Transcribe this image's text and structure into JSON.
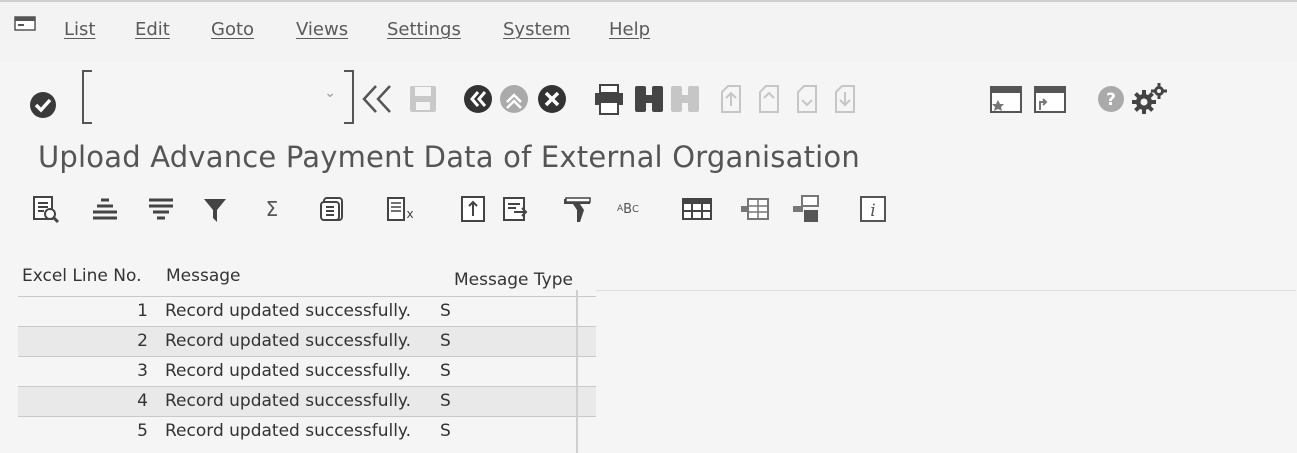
{
  "menu": {
    "items": [
      "List",
      "Edit",
      "Goto",
      "Views",
      "Settings",
      "System",
      "Help"
    ]
  },
  "toolbar": {
    "command_field_value": "",
    "icons": [
      "enter-icon",
      "back-double-chevron-icon",
      "save-icon",
      "back-icon",
      "exit-icon",
      "cancel-icon",
      "print-icon",
      "find-icon",
      "find-next-icon",
      "first-page-icon",
      "previous-page-icon",
      "next-page-icon",
      "last-page-icon",
      "create-session-icon",
      "generate-shortcut-icon",
      "help-icon",
      "settings-gear-icon"
    ]
  },
  "page": {
    "title": "Upload Advance Payment Data of External Organisation"
  },
  "alv_toolbar": {
    "icons": [
      "details-icon",
      "sort-ascending-icon",
      "sort-descending-icon",
      "filter-icon",
      "sum-icon",
      "subtotal-icon",
      "print-preview-icon",
      "export-icon",
      "layout-icon",
      "views-icon",
      "abc-analysis-icon",
      "grid-icon",
      "graphic-icon",
      "choose-layout-icon",
      "info-icon"
    ]
  },
  "table": {
    "headers": [
      "Excel Line No.",
      "Message",
      "Message Type"
    ],
    "rows": [
      {
        "line": "1",
        "message": "Record updated successfully.",
        "type": "S"
      },
      {
        "line": "2",
        "message": "Record updated successfully.",
        "type": "S"
      },
      {
        "line": "3",
        "message": "Record updated successfully.",
        "type": "S"
      },
      {
        "line": "4",
        "message": "Record updated successfully.",
        "type": "S"
      },
      {
        "line": "5",
        "message": "Record updated successfully.",
        "type": "S"
      }
    ]
  },
  "colors": {
    "background": "#f4f5f4",
    "icon_dark": "#3a3a3a",
    "icon_disabled": "#c4c4c4",
    "row_alt": "#e8e9e8"
  }
}
